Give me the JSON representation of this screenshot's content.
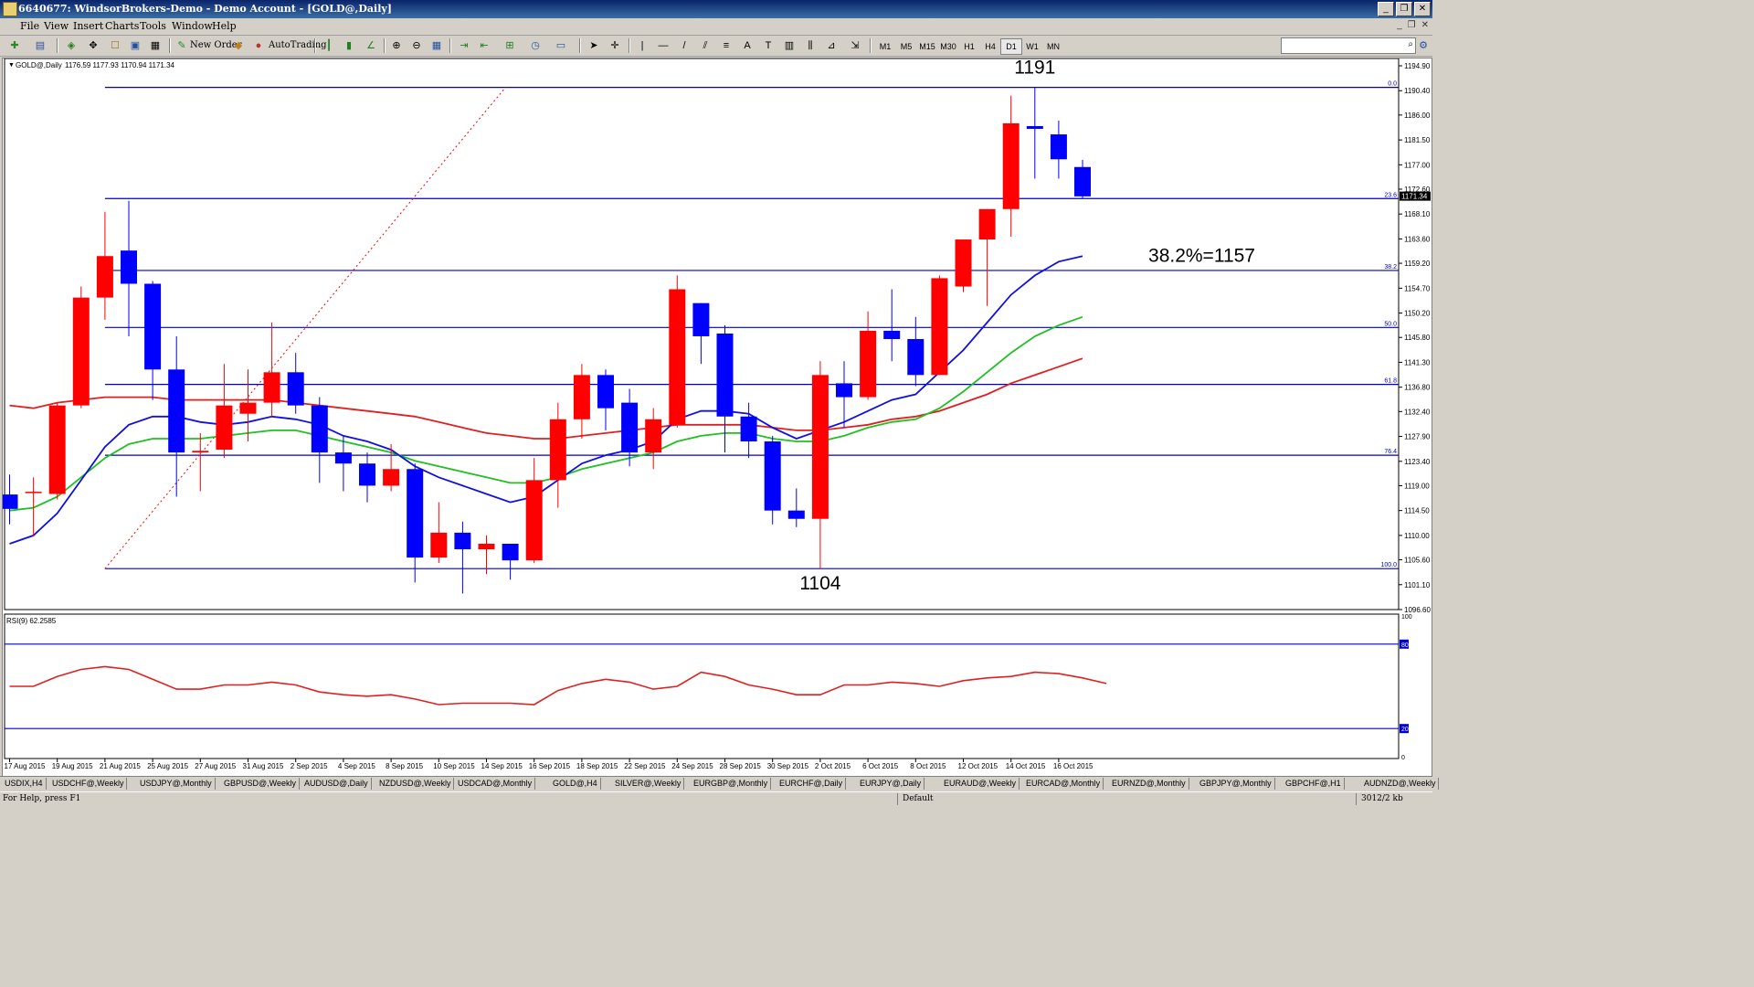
{
  "window": {
    "title": "6640677: WindsorBrokers-Demo - Demo Account - [GOLD@,Daily]",
    "buttons": [
      "_",
      "❐",
      "✕"
    ]
  },
  "menu": [
    "File",
    "View",
    "Insert",
    "Charts",
    "Tools",
    "Window",
    "Help"
  ],
  "mdi_buttons": [
    "_",
    "❐",
    "✕"
  ],
  "toolbar": {
    "new_order": "New Order",
    "autotrading": "AutoTrading",
    "line_tools": [
      "|",
      "—",
      "/",
      "≡",
      "A",
      "T"
    ],
    "timeframes": [
      "M1",
      "M5",
      "M15",
      "M30",
      "H1",
      "H4",
      "D1",
      "W1",
      "MN"
    ],
    "active_timeframe": "D1",
    "search_value": ""
  },
  "chart_data": {
    "type": "candlestick",
    "symbol_label": "GOLD@,Daily",
    "ohlc_label": "1176.59 1177.93 1170.94 1171.34",
    "current_price": "1171.34",
    "ylim": [
      1096.6,
      1194.9
    ],
    "price_ticks": [
      "1194.90",
      "1190.40",
      "1186.00",
      "1181.50",
      "1177.00",
      "1172.60",
      "1168.10",
      "1163.60",
      "1159.20",
      "1154.70",
      "1150.20",
      "1145.80",
      "1141.30",
      "1136.80",
      "1132.40",
      "1127.90",
      "1123.40",
      "1119.00",
      "1114.50",
      "1110.00",
      "1105.60",
      "1101.10",
      "1096.60"
    ],
    "date_ticks": [
      "17 Aug 2015",
      "19 Aug 2015",
      "21 Aug 2015",
      "25 Aug 2015",
      "27 Aug 2015",
      "31 Aug 2015",
      "2 Sep 2015",
      "4 Sep 2015",
      "8 Sep 2015",
      "10 Sep 2015",
      "14 Sep 2015",
      "16 Sep 2015",
      "18 Sep 2015",
      "22 Sep 2015",
      "24 Sep 2015",
      "28 Sep 2015",
      "30 Sep 2015",
      "2 Oct 2015",
      "6 Oct 2015",
      "8 Oct 2015",
      "12 Oct 2015",
      "14 Oct 2015",
      "16 Oct 2015"
    ],
    "candles": [
      {
        "o": 1117.4,
        "h": 1121.0,
        "l": 1112.0,
        "c": 1114.8
      },
      {
        "o": 1117.7,
        "h": 1120.5,
        "l": 1109.8,
        "c": 1117.9
      },
      {
        "o": 1117.5,
        "h": 1134.0,
        "l": 1116.5,
        "c": 1133.5
      },
      {
        "o": 1133.5,
        "h": 1155.0,
        "l": 1133.0,
        "c": 1153.0
      },
      {
        "o": 1153.0,
        "h": 1168.5,
        "l": 1149.0,
        "c": 1160.5
      },
      {
        "o": 1161.5,
        "h": 1170.5,
        "l": 1146.0,
        "c": 1155.5
      },
      {
        "o": 1155.5,
        "h": 1156.0,
        "l": 1134.5,
        "c": 1140.0
      },
      {
        "o": 1140.0,
        "h": 1146.0,
        "l": 1117.0,
        "c": 1125.0
      },
      {
        "o": 1125.0,
        "h": 1128.5,
        "l": 1118.0,
        "c": 1125.3
      },
      {
        "o": 1125.5,
        "h": 1141.0,
        "l": 1124.0,
        "c": 1133.5
      },
      {
        "o": 1132.0,
        "h": 1140.0,
        "l": 1127.0,
        "c": 1134.0
      },
      {
        "o": 1134.0,
        "h": 1148.5,
        "l": 1131.5,
        "c": 1139.5
      },
      {
        "o": 1139.5,
        "h": 1143.0,
        "l": 1132.0,
        "c": 1133.5
      },
      {
        "o": 1133.5,
        "h": 1135.0,
        "l": 1119.5,
        "c": 1125.0
      },
      {
        "o": 1125.0,
        "h": 1128.0,
        "l": 1118.0,
        "c": 1123.0
      },
      {
        "o": 1123.0,
        "h": 1125.0,
        "l": 1116.0,
        "c": 1119.0
      },
      {
        "o": 1119.0,
        "h": 1126.5,
        "l": 1118.0,
        "c": 1122.0
      },
      {
        "o": 1122.0,
        "h": 1123.0,
        "l": 1101.5,
        "c": 1106.0
      },
      {
        "o": 1106.0,
        "h": 1116.0,
        "l": 1105.0,
        "c": 1110.5
      },
      {
        "o": 1110.5,
        "h": 1112.5,
        "l": 1099.5,
        "c": 1107.5
      },
      {
        "o": 1107.5,
        "h": 1110.0,
        "l": 1103.0,
        "c": 1108.5
      },
      {
        "o": 1108.5,
        "h": 1108.5,
        "l": 1102.0,
        "c": 1105.5
      },
      {
        "o": 1105.5,
        "h": 1124.0,
        "l": 1105.0,
        "c": 1120.0
      },
      {
        "o": 1120.0,
        "h": 1134.0,
        "l": 1115.0,
        "c": 1131.0
      },
      {
        "o": 1131.0,
        "h": 1141.0,
        "l": 1127.5,
        "c": 1139.0
      },
      {
        "o": 1139.0,
        "h": 1140.0,
        "l": 1129.0,
        "c": 1133.0
      },
      {
        "o": 1134.0,
        "h": 1136.5,
        "l": 1122.5,
        "c": 1125.0
      },
      {
        "o": 1125.0,
        "h": 1133.0,
        "l": 1122.0,
        "c": 1131.0
      },
      {
        "o": 1130.0,
        "h": 1157.0,
        "l": 1129.5,
        "c": 1154.5
      },
      {
        "o": 1152.0,
        "h": 1152.0,
        "l": 1141.0,
        "c": 1146.0
      },
      {
        "o": 1146.5,
        "h": 1148.0,
        "l": 1125.0,
        "c": 1131.5
      },
      {
        "o": 1131.5,
        "h": 1134.0,
        "l": 1124.0,
        "c": 1127.0
      },
      {
        "o": 1127.0,
        "h": 1128.0,
        "l": 1112.0,
        "c": 1114.5
      },
      {
        "o": 1114.5,
        "h": 1118.5,
        "l": 1111.5,
        "c": 1113.0
      },
      {
        "o": 1113.0,
        "h": 1141.5,
        "l": 1104.0,
        "c": 1139.0
      },
      {
        "o": 1137.5,
        "h": 1141.5,
        "l": 1129.5,
        "c": 1135.0
      },
      {
        "o": 1135.0,
        "h": 1150.5,
        "l": 1134.5,
        "c": 1147.0
      },
      {
        "o": 1147.0,
        "h": 1154.5,
        "l": 1141.5,
        "c": 1145.5
      },
      {
        "o": 1145.5,
        "h": 1149.5,
        "l": 1137.0,
        "c": 1139.0
      },
      {
        "o": 1139.0,
        "h": 1157.0,
        "l": 1139.0,
        "c": 1156.5
      },
      {
        "o": 1155.0,
        "h": 1160.0,
        "l": 1154.0,
        "c": 1163.5
      },
      {
        "o": 1163.5,
        "h": 1169.0,
        "l": 1151.5,
        "c": 1169.0
      },
      {
        "o": 1169.0,
        "h": 1189.5,
        "l": 1164.0,
        "c": 1184.5
      },
      {
        "o": 1184.0,
        "h": 1191.0,
        "l": 1174.5,
        "c": 1183.5
      },
      {
        "o": 1182.5,
        "h": 1185.0,
        "l": 1174.5,
        "c": 1178.0
      },
      {
        "o": 1176.6,
        "h": 1177.9,
        "l": 1170.9,
        "c": 1171.3
      }
    ],
    "ma_blue": [
      1108.5,
      1110,
      1114,
      1120,
      1126,
      1130,
      1131.5,
      1131.5,
      1130.5,
      1130,
      1130.5,
      1131.5,
      1131,
      1130,
      1128,
      1127,
      1125.5,
      1122.5,
      1120.5,
      1119,
      1117.5,
      1116,
      1117,
      1120,
      1123,
      1124.5,
      1125.5,
      1127,
      1131,
      1132.5,
      1132.5,
      1132,
      1129.5,
      1127.5,
      1129,
      1130.5,
      1132.5,
      1134.5,
      1135.5,
      1139.5,
      1143.5,
      1148.5,
      1153.5,
      1157,
      1159.5,
      1160.5
    ],
    "ma_green": [
      1114.5,
      1115,
      1117,
      1120.5,
      1124,
      1126.5,
      1127.5,
      1127.5,
      1127.5,
      1128,
      1128.5,
      1129,
      1129,
      1128,
      1127,
      1126,
      1125,
      1123.5,
      1122.5,
      1121.5,
      1120.5,
      1119.5,
      1119.5,
      1120.5,
      1122,
      1123,
      1124,
      1125,
      1127,
      1128,
      1128.5,
      1128.5,
      1127.5,
      1127,
      1127,
      1128,
      1129.5,
      1130.5,
      1131,
      1133,
      1136,
      1139.5,
      1143,
      1146,
      1148,
      1149.5
    ],
    "ma_red": [
      1133.5,
      1133,
      1134,
      1134.5,
      1135,
      1135,
      1135,
      1134.5,
      1134.5,
      1134.5,
      1134.5,
      1134.5,
      1134,
      1133.5,
      1133,
      1132.5,
      1132,
      1131.5,
      1130.5,
      1129.5,
      1128.5,
      1128,
      1127.5,
      1127.5,
      1128,
      1128.5,
      1129,
      1129.5,
      1130,
      1130,
      1130,
      1130,
      1129.5,
      1129,
      1129,
      1129.5,
      1130,
      1131,
      1131.5,
      1132.5,
      1134,
      1135.5,
      1137.5,
      1139,
      1140.5,
      1142
    ],
    "fib_levels": [
      {
        "label": "0.0",
        "price": 1191.0
      },
      {
        "label": "23.6",
        "price": 1170.9
      },
      {
        "label": "38.2",
        "price": 1157.9
      },
      {
        "label": "50.0",
        "price": 1147.6
      },
      {
        "label": "61.8",
        "price": 1137.3
      },
      {
        "label": "76.4",
        "price": 1124.5
      },
      {
        "label": "100.0",
        "price": 1104.0
      }
    ],
    "annotations": [
      {
        "text": "1191",
        "price": 1193.5,
        "index": 43
      },
      {
        "text": "38.2%=1157",
        "price": 1159.5,
        "index": 50
      },
      {
        "text": "1104",
        "price": 1100.2,
        "index": 34
      }
    ],
    "rsi": {
      "label": "RSI(9) 62.2585",
      "levels": [
        "100",
        "80",
        "20",
        "0"
      ],
      "values": [
        50,
        50,
        57,
        62,
        64,
        62,
        55,
        48,
        48,
        51,
        51,
        53,
        51,
        46,
        44,
        43,
        44,
        41,
        37,
        38,
        38,
        38,
        37,
        47,
        52,
        55,
        53,
        48,
        50,
        60,
        57,
        51,
        48,
        44,
        44,
        51,
        51,
        53,
        52,
        50,
        54,
        56,
        57,
        60,
        59,
        56,
        52
      ]
    }
  },
  "symbol_tabs": [
    "USDIX,H4",
    "USDCHF@,Weekly",
    "USDJPY@,Monthly",
    "GBPUSD@,Weekly",
    "AUDUSD@,Daily",
    "NZDUSD@,Weekly",
    "USDCAD@,Monthly",
    "GOLD@,H4",
    "SILVER@,Weekly",
    "EURGBP@,Monthly",
    "EURCHF@,Daily",
    "EURJPY@,Daily",
    "EURAUD@,Weekly",
    "EURCAD@,Monthly",
    "EURNZD@,Monthly",
    "GBPJPY@,Monthly",
    "GBPCHF@,H1",
    "AUDNZD@,Weekly"
  ],
  "status": {
    "help": "For Help, press F1",
    "profile": "Default",
    "connection": "3012/2 kb"
  }
}
